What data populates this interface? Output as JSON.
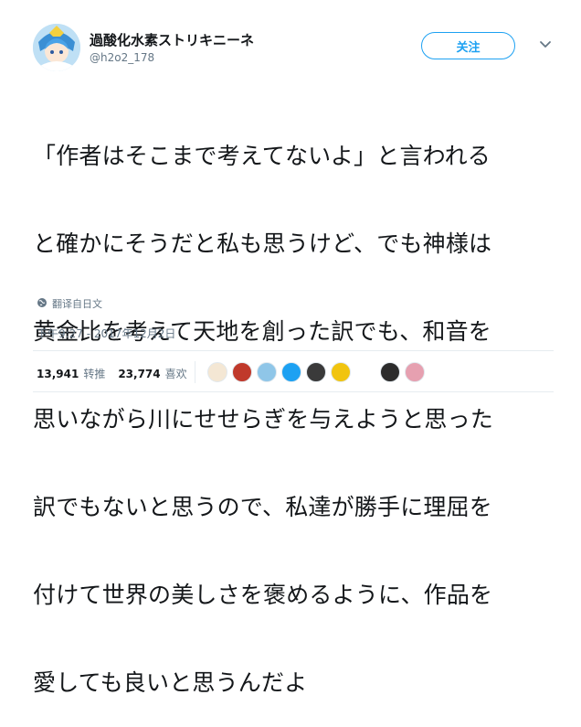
{
  "author": {
    "display_name": "過酸化水素ストリキニーネ",
    "handle": "@h2o2_178"
  },
  "follow_button": {
    "label": "关注"
  },
  "tweet": {
    "lines": [
      "「作者はそこまで考えてないよ」と言われる",
      "と確かにそうだと私も思うけど、でも神様は",
      "黄金比を考えて天地を創った訳でも、和音を",
      "思いながら川にせせらぎを与えようと思った",
      "訳でもないと思うので、私達が勝手に理屈を",
      "付けて世界の美しさを褒めるように、作品を",
      "愛しても良いと思うんだよ"
    ],
    "translate_label": "翻译自日文",
    "timestamp": "下午9:27 - 2017年12月2日"
  },
  "stats": {
    "retweets_count": "13,941",
    "retweets_label": "转推",
    "likes_count": "23,774",
    "likes_label": "喜欢"
  },
  "liker_colors": [
    "#f4e7d4",
    "#c0392b",
    "#8fc6e8",
    "#1da1f2",
    "#3a3a3a",
    "#f1c40f",
    "#ffffff",
    "#2c2c2c",
    "#e6a0b0"
  ],
  "accent_color": "#1da1f2"
}
